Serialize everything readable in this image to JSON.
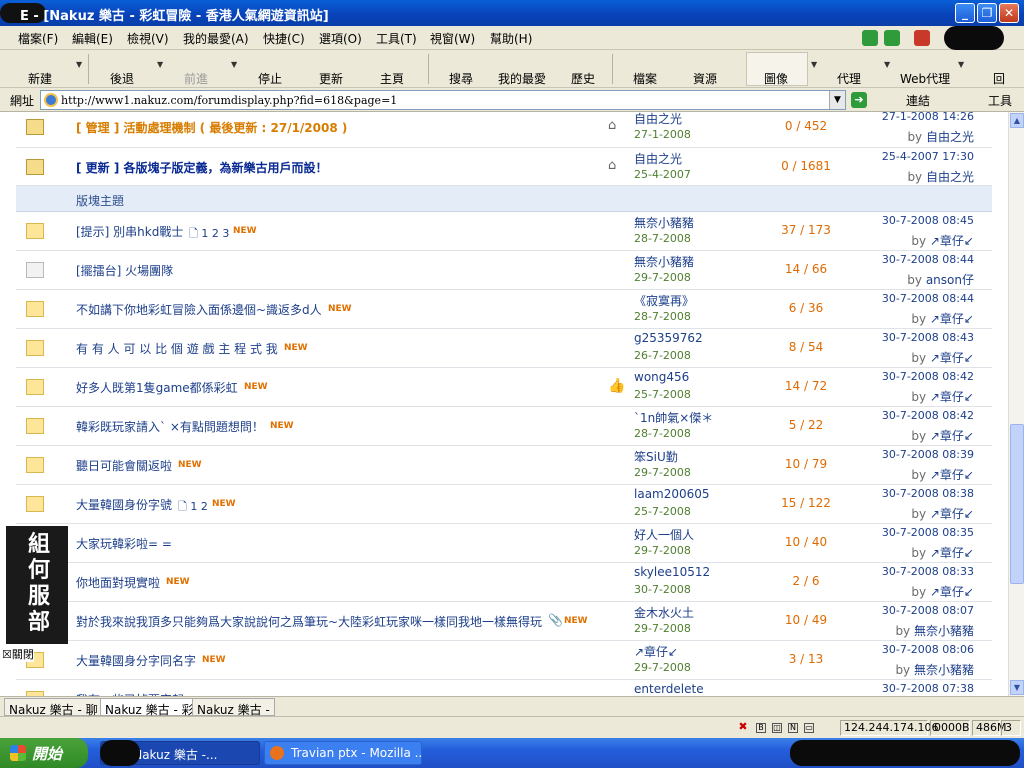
{
  "window": {
    "title": "E - [Nakuz 樂古 - 彩虹冒險 - 香港人氣網遊資訊站]",
    "min": "_",
    "max": "❐",
    "close": "✕"
  },
  "menu": [
    "檔案(F)",
    "編輯(E)",
    "檢視(V)",
    "我的最愛(A)",
    "快捷(C)",
    "選項(O)",
    "工具(T)",
    "視窗(W)",
    "幫助(H)"
  ],
  "toolbar": {
    "new": "新建",
    "back": "後退",
    "forward": "前進",
    "stop": "停止",
    "refresh": "更新",
    "home": "主頁",
    "search": "搜尋",
    "favorites": "我的最愛",
    "history": "歷史",
    "files": "檔案",
    "resources": "資源",
    "images": "圖像",
    "proxy": "代理",
    "webproxy": "Web代理",
    "back2": "回"
  },
  "address": {
    "label": "網址",
    "url": "http://www1.nakuz.com/forumdisplay.php?fid=618&page=1",
    "links": "連結",
    "tools": "工具"
  },
  "sticky": [
    {
      "title": "[ 管理 ] 活動處理機制 ( 最後更新 : 27/1/2008 )",
      "author": "自由之光",
      "date": "27-1-2008",
      "counts": "0 / 452",
      "last_time": "27-1-2008 14:26",
      "last_by": "自由之光"
    },
    {
      "title": "[ 更新 ] 各版塊子版定義，為新樂古用戶而設！",
      "author": "自由之光",
      "date": "25-4-2007",
      "counts": "0 / 1681",
      "last_time": "25-4-2007 17:30",
      "last_by": "自由之光"
    }
  ],
  "section_label": "版塊主題",
  "threads": [
    {
      "title": "[提示] 別串hkd戰士",
      "pages": "1  2  3",
      "new": "NEW",
      "author": "無奈小豬豬",
      "date": "28-7-2008",
      "counts": "37 / 173",
      "last_time": "30-7-2008 08:45",
      "last_by": "↗章仔↙"
    },
    {
      "title": "[擺擂台] 火場團隊",
      "pages": "",
      "new": "",
      "author": "無奈小豬豬",
      "date": "29-7-2008",
      "counts": "14 / 66",
      "last_time": "30-7-2008 08:44",
      "last_by": "anson仔"
    },
    {
      "title": "不如講下你地彩虹冒險入面係邊個~識返多d人",
      "pages": "",
      "new": "NEW",
      "author": "《寂寞再》",
      "date": "28-7-2008",
      "counts": "6 / 36",
      "last_time": "30-7-2008 08:44",
      "last_by": "↗章仔↙"
    },
    {
      "title": "有 有 人 可 以 比 個 遊  戲  主  程  式 我",
      "pages": "",
      "new": "NEW",
      "author": "g25359762",
      "date": "26-7-2008",
      "counts": "8 / 54",
      "last_time": "30-7-2008 08:43",
      "last_by": "↗章仔↙"
    },
    {
      "title": "好多人既第1隻game都係彩虹",
      "pages": "",
      "new": "NEW",
      "author": "wong456",
      "date": "25-7-2008",
      "counts": "14 / 72",
      "last_time": "30-7-2008 08:42",
      "last_by": "↗章仔↙"
    },
    {
      "title": "韓彩既玩家請入` ×有點問題想問！",
      "pages": "",
      "new": "NEW",
      "author": "`1n帥氣×傑＊",
      "date": "28-7-2008",
      "counts": "5 / 22",
      "last_time": "30-7-2008 08:42",
      "last_by": "↗章仔↙"
    },
    {
      "title": "聽日可能會關返啦",
      "pages": "",
      "new": "NEW",
      "author": "笨SiU勤",
      "date": "29-7-2008",
      "counts": "10 / 79",
      "last_time": "30-7-2008 08:39",
      "last_by": "↗章仔↙"
    },
    {
      "title": "大量韓國身份字號",
      "pages": "1  2",
      "new": "NEW",
      "author": "laam200605",
      "date": "25-7-2008",
      "counts": "15 / 122",
      "last_time": "30-7-2008 08:38",
      "last_by": "↗章仔↙"
    },
    {
      "title": "大家玩韓彩啦= =",
      "pages": "",
      "new": "",
      "author": "好人一個人",
      "date": "29-7-2008",
      "counts": "10 / 40",
      "last_time": "30-7-2008 08:35",
      "last_by": "↗章仔↙"
    },
    {
      "title": "你地面對現實啦",
      "pages": "",
      "new": "NEW",
      "author": "skylee10512",
      "date": "30-7-2008",
      "counts": "2 / 6",
      "last_time": "30-7-2008 08:33",
      "last_by": "↗章仔↙"
    },
    {
      "title": "對於我來說我頂多只能夠爲大家說說何之爲筆玩~大陸彩虹玩家咪一樣同我地一樣無得玩",
      "pages": "",
      "new": "NEW",
      "author": "金木水火土",
      "date": "29-7-2008",
      "counts": "10 / 49",
      "last_time": "30-7-2008 08:07",
      "last_by": "無奈小豬豬"
    },
    {
      "title": "大量韓國身分字同名字",
      "pages": "",
      "new": "NEW",
      "author": "↗章仔↙",
      "date": "29-7-2008",
      "counts": "3 / 13",
      "last_time": "30-7-2008 08:06",
      "last_by": "無奈小豬豬"
    },
    {
      "title": "我有一些已掉要定起",
      "pages": "",
      "new": "",
      "author": "enterdelete",
      "date": "",
      "counts": "",
      "last_time": "30-7-2008 07:38",
      "last_by": ""
    }
  ],
  "by_word": "by",
  "ad": {
    "text": "組 何 服 部",
    "close": "關閉"
  },
  "tabs": [
    "Nakuz 樂古 - 聊",
    "Nakuz 樂古 - 彩",
    "Nakuz 樂古 -"
  ],
  "status": {
    "ip": "124.244.174.106",
    "bytes": "0000B",
    "mem": "486M",
    "num": "3"
  },
  "taskbar": {
    "start": "開始",
    "task1": "E - [Nakuz 樂古 -...",
    "task2": "Travian ptx - Mozilla ..."
  }
}
